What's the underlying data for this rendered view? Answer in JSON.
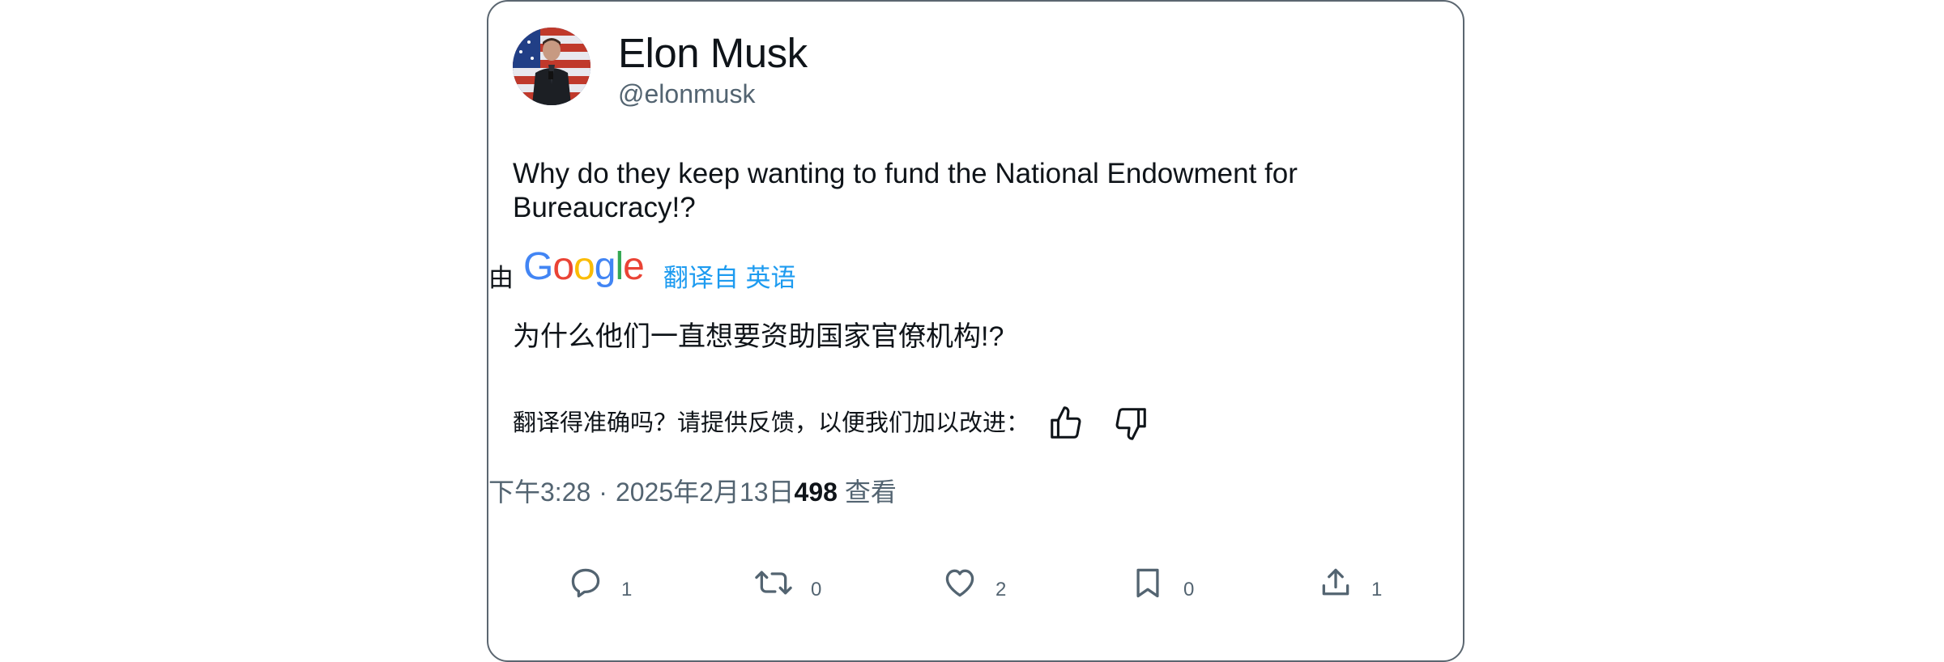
{
  "author": {
    "display_name": "Elon Musk",
    "handle": "@elonmusk"
  },
  "tweet": {
    "text": "Why do they keep wanting to fund the National Endowment for Bureaucracy!?"
  },
  "translation": {
    "by_label": "由",
    "logo_letters": [
      "G",
      "o",
      "o",
      "g",
      "l",
      "e"
    ],
    "logo_colors": [
      "#4285F4",
      "#EA4335",
      "#FBBC05",
      "#4285F4",
      "#34A853",
      "#EA4335"
    ],
    "link_text": "翻译自 英语",
    "translated_text": "为什么他们一直想要资助国家官僚机构!?",
    "feedback_text": "翻译得准确吗？请提供反馈，以便我们加以改进："
  },
  "meta": {
    "time": "下午3:28",
    "separator": "·",
    "date": "2025年2月13日",
    "views_count": "498",
    "views_label": " 查看"
  },
  "actions": {
    "reply_count": "1",
    "retweet_count": "0",
    "like_count": "2",
    "bookmark_count": "0",
    "share_count": "1"
  },
  "colors": {
    "link": "#1d9bf0",
    "secondary_text": "#536471",
    "border": "#5b6670"
  }
}
